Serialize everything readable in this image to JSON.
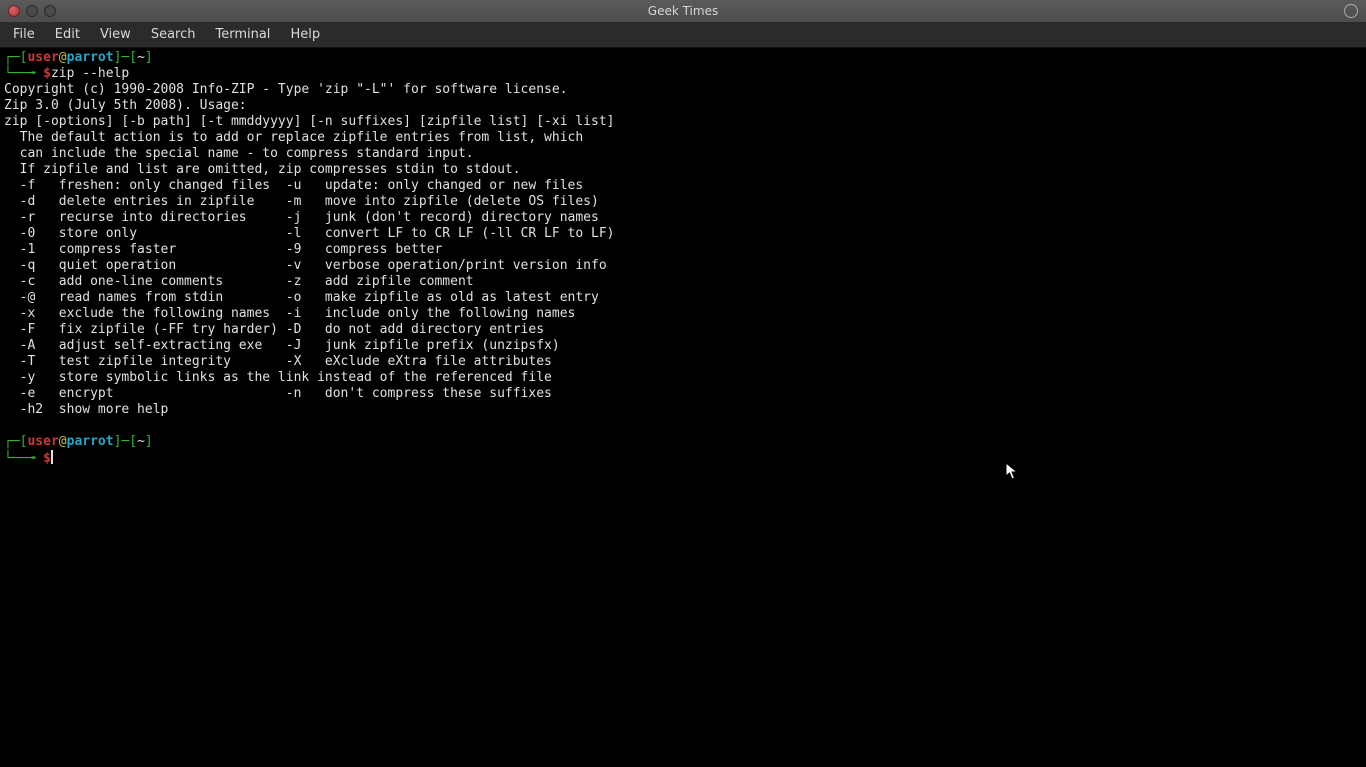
{
  "window": {
    "title": "Geek Times"
  },
  "menu": {
    "file": "File",
    "edit": "Edit",
    "view": "View",
    "search": "Search",
    "terminal": "Terminal",
    "help": "Help"
  },
  "prompt": {
    "user": "user",
    "at": "@",
    "host": "parrot",
    "brL": "[",
    "brR": "]",
    "dash": "─",
    "dash2": "─[",
    "tilde": "~",
    "close": "]",
    "corner_top": "┌─",
    "corner_bot": "└──╼ ",
    "dollar": "$",
    "command1": "zip --help"
  },
  "output": {
    "l1": "Copyright (c) 1990-2008 Info-ZIP - Type 'zip \"-L\"' for software license.",
    "l2": "Zip 3.0 (July 5th 2008). Usage:",
    "l3": "zip [-options] [-b path] [-t mmddyyyy] [-n suffixes] [zipfile list] [-xi list]",
    "l4": "  The default action is to add or replace zipfile entries from list, which",
    "l5": "  can include the special name - to compress standard input.",
    "l6": "  If zipfile and list are omitted, zip compresses stdin to stdout.",
    "l7": "  -f   freshen: only changed files  -u   update: only changed or new files",
    "l8": "  -d   delete entries in zipfile    -m   move into zipfile (delete OS files)",
    "l9": "  -r   recurse into directories     -j   junk (don't record) directory names",
    "l10": "  -0   store only                   -l   convert LF to CR LF (-ll CR LF to LF)",
    "l11": "  -1   compress faster              -9   compress better",
    "l12": "  -q   quiet operation              -v   verbose operation/print version info",
    "l13": "  -c   add one-line comments        -z   add zipfile comment",
    "l14": "  -@   read names from stdin        -o   make zipfile as old as latest entry",
    "l15": "  -x   exclude the following names  -i   include only the following names",
    "l16": "  -F   fix zipfile (-FF try harder) -D   do not add directory entries",
    "l17": "  -A   adjust self-extracting exe   -J   junk zipfile prefix (unzipsfx)",
    "l18": "  -T   test zipfile integrity       -X   eXclude eXtra file attributes",
    "l19": "  -y   store symbolic links as the link instead of the referenced file",
    "l20": "  -e   encrypt                      -n   don't compress these suffixes",
    "l21": "  -h2  show more help"
  }
}
